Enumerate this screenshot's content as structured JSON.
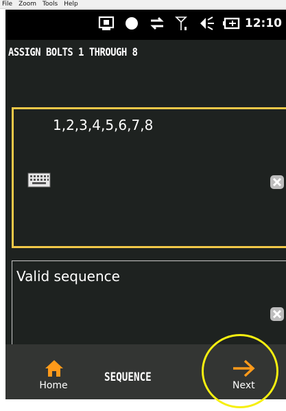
{
  "menubar": {
    "items": [
      "File",
      "Zoom",
      "Tools",
      "Help"
    ]
  },
  "statusbar": {
    "icons": [
      "screen-icon",
      "record-dot-icon",
      "sync-arrows-icon",
      "signal-icon",
      "speaker-icon",
      "battery-icon"
    ],
    "time": "12:10"
  },
  "screen": {
    "heading": "ASSIGN BOLTS 1 THROUGH 8",
    "input": {
      "value": "1,2,3,4,5,6,7,8",
      "border_color": "#f2c848"
    },
    "message": "Valid sequence"
  },
  "bottombar": {
    "home_label": "Home",
    "title": "SEQUENCE",
    "next_label": "Next",
    "accent_color": "#ff9a1a",
    "highlight_color": "#f6ef10"
  }
}
